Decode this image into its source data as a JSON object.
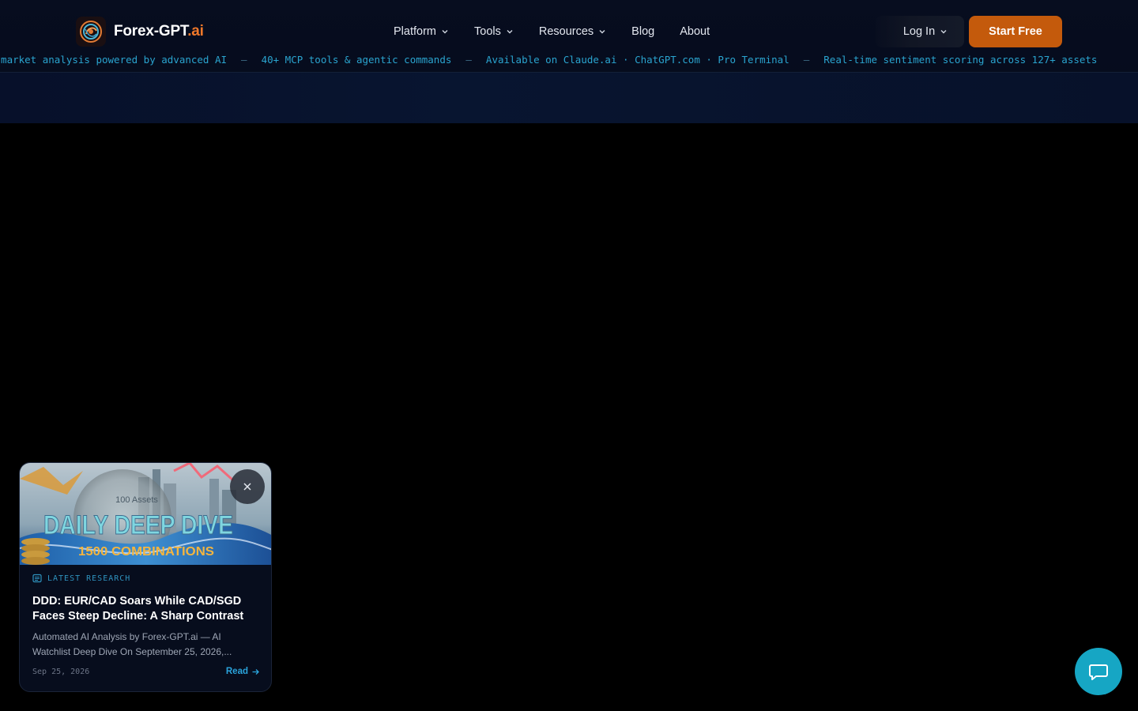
{
  "brand": {
    "name": "Forex-GPT",
    "suffix": ".ai"
  },
  "nav": {
    "items": [
      {
        "label": "Platform",
        "dropdown": true
      },
      {
        "label": "Tools",
        "dropdown": true
      },
      {
        "label": "Resources",
        "dropdown": true
      },
      {
        "label": "Blog",
        "dropdown": false
      },
      {
        "label": "About",
        "dropdown": false
      }
    ]
  },
  "auth": {
    "login_label": "Log In",
    "start_label": "Start Free"
  },
  "ticker": {
    "items": [
      "e market analysis powered by advanced AI",
      "40+ MCP tools & agentic commands",
      "Available on Claude.ai · ChatGPT.com · Pro Terminal",
      "Real-time sentiment scoring across 127+ assets"
    ],
    "separator": "—"
  },
  "research_card": {
    "image": {
      "overline": "100 Assets",
      "headline": "DAILY DEEP DIVE",
      "subline": "1500 COMBINATIONS"
    },
    "tag": "LATEST RESEARCH",
    "title": "DDD: EUR/CAD Soars While CAD/SGD Faces Steep Decline: A Sharp Contrast",
    "description": "Automated AI Analysis by Forex-GPT.ai — AI Watchlist Deep Dive On September 25, 2026,...",
    "date": "Sep 25, 2026",
    "read_label": "Read",
    "close_icon": "close-icon"
  },
  "chat": {
    "icon": "chat-bubble-icon"
  },
  "colors": {
    "accent": "#c45a0c",
    "brand_orange": "#f0782a",
    "ticker": "#2aa4cf",
    "chat": "#16a6c4",
    "link": "#2aa4dc"
  }
}
